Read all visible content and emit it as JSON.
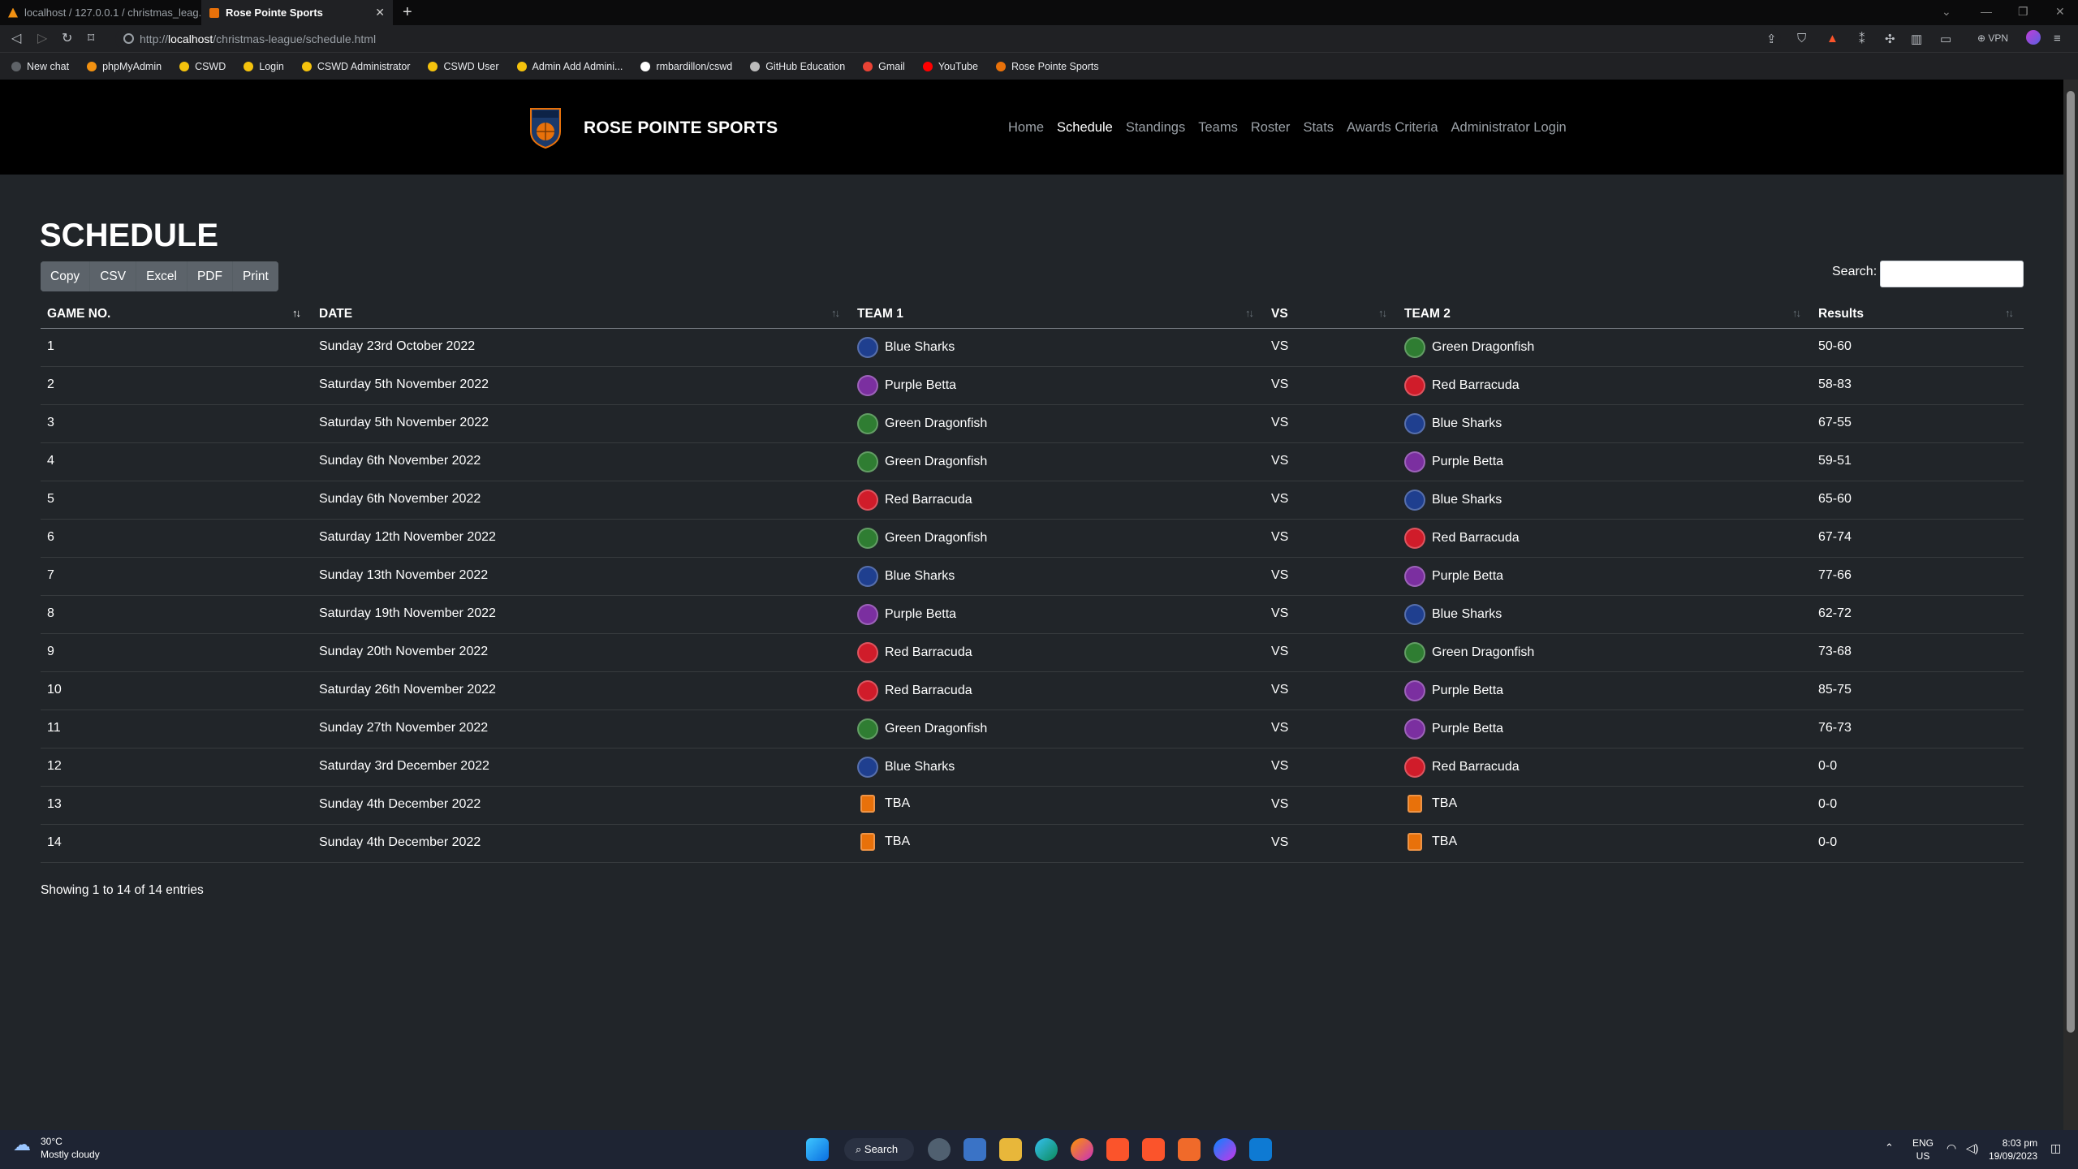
{
  "browser": {
    "tabs": [
      {
        "label": "localhost / 127.0.0.1 / christmas_leag..."
      },
      {
        "label": "Rose Pointe Sports"
      }
    ],
    "url_prefix": "http://",
    "url_host": "localhost",
    "url_path": "/christmas-league/schedule.html",
    "vpn_label": "VPN",
    "bookmarks": [
      {
        "label": "New chat",
        "color": "#5f6368"
      },
      {
        "label": "phpMyAdmin",
        "color": "#f29111"
      },
      {
        "label": "CSWD",
        "color": "#f4c20d"
      },
      {
        "label": "Login",
        "color": "#f4c20d"
      },
      {
        "label": "CSWD Administrator",
        "color": "#f4c20d"
      },
      {
        "label": "CSWD User",
        "color": "#f4c20d"
      },
      {
        "label": "Admin Add Admini...",
        "color": "#f4c20d"
      },
      {
        "label": "rmbardillon/cswd",
        "color": "#ffffff"
      },
      {
        "label": "GitHub Education",
        "color": "#bbbbbb"
      },
      {
        "label": "Gmail",
        "color": "#ea4335"
      },
      {
        "label": "YouTube",
        "color": "#ff0000"
      },
      {
        "label": "Rose Pointe Sports",
        "color": "#e8710a"
      }
    ]
  },
  "site": {
    "brand": "ROSE POINTE SPORTS",
    "nav": [
      "Home",
      "Schedule",
      "Standings",
      "Teams",
      "Roster",
      "Stats",
      "Awards Criteria",
      "Administrator Login"
    ],
    "active_nav": "Schedule"
  },
  "page": {
    "title": "SCHEDULE",
    "export_buttons": [
      "Copy",
      "CSV",
      "Excel",
      "PDF",
      "Print"
    ],
    "search_label": "Search:",
    "search_value": "",
    "showing": "Showing 1 to 14 of 14 entries"
  },
  "table": {
    "headers": [
      "GAME NO.",
      "DATE",
      "TEAM 1",
      "VS",
      "TEAM 2",
      "Results"
    ],
    "team_colors": {
      "Blue Sharks": "#1f3f8f",
      "Purple Betta": "#7b2fa0",
      "Green Dragonfish": "#2f7d32",
      "Red Barracuda": "#d01c2a",
      "TBA": "#e8710a"
    },
    "rows": [
      {
        "no": "1",
        "date": "Sunday 23rd October 2022",
        "team1": "Blue Sharks",
        "vs": "VS",
        "team2": "Green Dragonfish",
        "result": "50-60"
      },
      {
        "no": "2",
        "date": "Saturday 5th November 2022",
        "team1": "Purple Betta",
        "vs": "VS",
        "team2": "Red Barracuda",
        "result": "58-83"
      },
      {
        "no": "3",
        "date": "Saturday 5th November 2022",
        "team1": "Green Dragonfish",
        "vs": "VS",
        "team2": "Blue Sharks",
        "result": "67-55"
      },
      {
        "no": "4",
        "date": "Sunday 6th November 2022",
        "team1": "Green Dragonfish",
        "vs": "VS",
        "team2": "Purple Betta",
        "result": "59-51"
      },
      {
        "no": "5",
        "date": "Sunday 6th November 2022",
        "team1": "Red Barracuda",
        "vs": "VS",
        "team2": "Blue Sharks",
        "result": "65-60"
      },
      {
        "no": "6",
        "date": "Saturday 12th November 2022",
        "team1": "Green Dragonfish",
        "vs": "VS",
        "team2": "Red Barracuda",
        "result": "67-74"
      },
      {
        "no": "7",
        "date": "Sunday 13th November 2022",
        "team1": "Blue Sharks",
        "vs": "VS",
        "team2": "Purple Betta",
        "result": "77-66"
      },
      {
        "no": "8",
        "date": "Saturday 19th November 2022",
        "team1": "Purple Betta",
        "vs": "VS",
        "team2": "Blue Sharks",
        "result": "62-72"
      },
      {
        "no": "9",
        "date": "Sunday 20th November 2022",
        "team1": "Red Barracuda",
        "vs": "VS",
        "team2": "Green Dragonfish",
        "result": "73-68"
      },
      {
        "no": "10",
        "date": "Saturday 26th November 2022",
        "team1": "Red Barracuda",
        "vs": "VS",
        "team2": "Purple Betta",
        "result": "85-75"
      },
      {
        "no": "11",
        "date": "Sunday 27th November 2022",
        "team1": "Green Dragonfish",
        "vs": "VS",
        "team2": "Purple Betta",
        "result": "76-73"
      },
      {
        "no": "12",
        "date": "Saturday 3rd December 2022",
        "team1": "Blue Sharks",
        "vs": "VS",
        "team2": "Red Barracuda",
        "result": "0-0"
      },
      {
        "no": "13",
        "date": "Sunday 4th December 2022",
        "team1": "TBA",
        "vs": "VS",
        "team2": "TBA",
        "result": "0-0"
      },
      {
        "no": "14",
        "date": "Sunday 4th December 2022",
        "team1": "TBA",
        "vs": "VS",
        "team2": "TBA",
        "result": "0-0"
      }
    ]
  },
  "taskbar": {
    "weather_temp": "30°C",
    "weather_desc": "Mostly cloudy",
    "search_label": "Search",
    "lang_1": "ENG",
    "lang_2": "US",
    "time": "8:03 pm",
    "date": "19/09/2023"
  }
}
